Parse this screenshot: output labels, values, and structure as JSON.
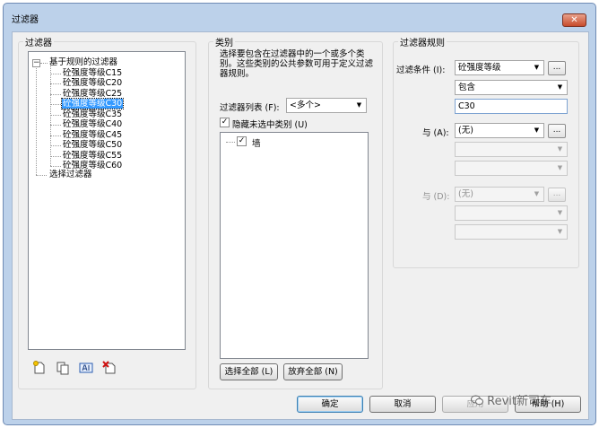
{
  "window": {
    "title": "过滤器",
    "close_glyph": "✕"
  },
  "filters": {
    "group_label": "过滤器",
    "root_label": "基于规则的过滤器",
    "items": [
      "砼强度等级C15",
      "砼强度等级C20",
      "砼强度等级C25",
      "砼强度等级C30",
      "砼强度等级C35",
      "砼强度等级C40",
      "砼强度等级C45",
      "砼强度等级C50",
      "砼强度等级C55",
      "砼强度等级C60"
    ],
    "selected_item": "砼强度等级C30",
    "selection_filter_label": "选择过滤器",
    "toolbar_icons": [
      "new-filter-icon",
      "duplicate-filter-icon",
      "rename-filter-icon",
      "delete-filter-icon"
    ]
  },
  "categories": {
    "group_label": "类别",
    "description": "选择要包含在过滤器中的一个或多个类别。这些类别的公共参数可用于定义过滤器规则。",
    "filter_list_label": "过滤器列表 (F):",
    "filter_list_value": "<多个>",
    "hide_unchecked_label": "隐藏未选中类别 (U)",
    "hide_unchecked_checked": true,
    "items": [
      {
        "label": "墙",
        "checked": true
      }
    ],
    "select_all_label": "选择全部 (L)",
    "deselect_all_label": "放弃全部 (N)"
  },
  "rules": {
    "group_label": "过滤器规则",
    "filter_by_label": "过滤条件 (I):",
    "parameter_value": "砼强度等级",
    "operator_value": "包含",
    "value_text": "C30",
    "and1_label": "与 (A):",
    "and1_value": "(无)",
    "and2_label": "与 (D):",
    "and2_value": "(无)",
    "dots_label": "..."
  },
  "footer": {
    "ok_label": "确定",
    "cancel_label": "取消",
    "apply_label": "应用",
    "help_label": "帮助 (H)"
  },
  "watermark": {
    "text": "Revit新司车"
  }
}
